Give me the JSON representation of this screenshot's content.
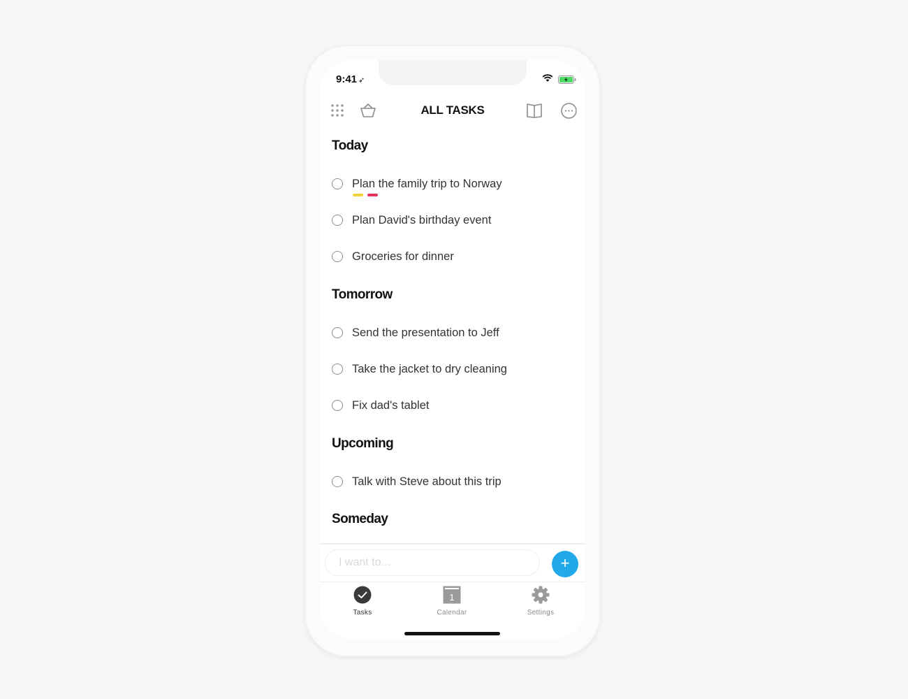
{
  "status": {
    "time": "9:41"
  },
  "header": {
    "title": "ALL TASKS"
  },
  "sections": {
    "today": {
      "title": "Today",
      "tasks": [
        "Plan the family trip to Norway",
        "Plan David's birthday event",
        "Groceries for dinner"
      ],
      "tag_colors": [
        "#f2d23a",
        "#e2335b"
      ]
    },
    "tomorrow": {
      "title": "Tomorrow",
      "tasks": [
        "Send the presentation to Jeff",
        "Take the jacket to dry cleaning",
        "Fix dad's tablet"
      ]
    },
    "upcoming": {
      "title": "Upcoming",
      "tasks": [
        "Talk with Steve about this trip"
      ]
    },
    "someday": {
      "title": "Someday"
    }
  },
  "composer": {
    "placeholder": "I want to...",
    "add_label": "+"
  },
  "tabbar": {
    "tasks": "Tasks",
    "calendar": "Calendar",
    "calendar_day": "1",
    "settings": "Settings"
  },
  "colors": {
    "accent": "#22a9ea",
    "battery": "#4cd964"
  }
}
